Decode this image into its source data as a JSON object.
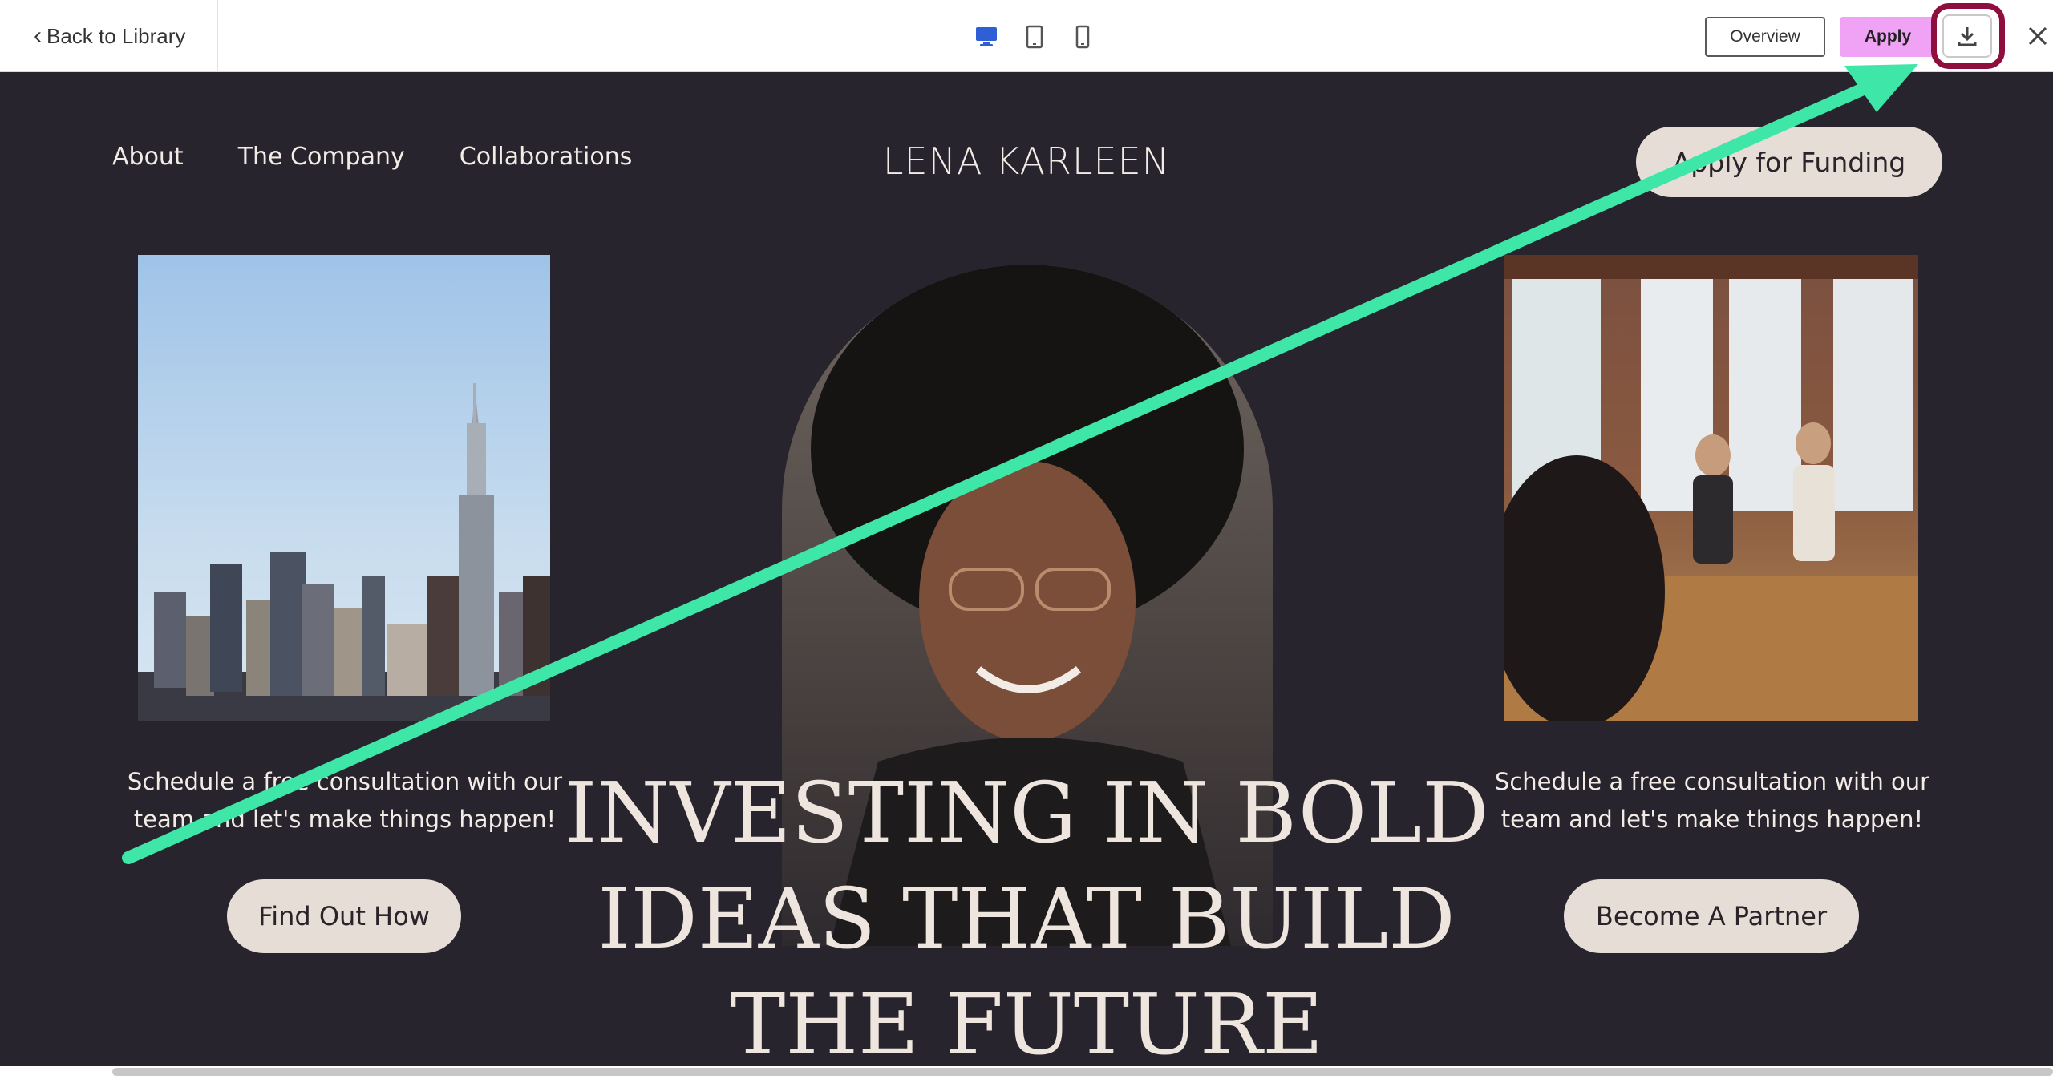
{
  "editor": {
    "back_label": "Back to Library",
    "devices": [
      "desktop-icon",
      "tablet-icon",
      "mobile-icon"
    ],
    "overview_label": "Overview",
    "apply_label": "Apply",
    "download_icon": "download-icon",
    "close_icon": "close-icon"
  },
  "site": {
    "nav": [
      "About",
      "The Company",
      "Collaborations"
    ],
    "brand": "LENA KARLEEN",
    "cta_label": "Apply for Funding",
    "left_caption": "Schedule a free consultation with our team and let's make things happen!",
    "left_button": "Find Out How",
    "right_caption": "Schedule a free consultation with our team and let's make things happen!",
    "right_button": "Become A Partner",
    "headline_lines": [
      "INVESTING IN BOLD",
      "IDEAS THAT BUILD",
      "THE FUTURE"
    ]
  },
  "colors": {
    "apply_bg": "#f0a2f4",
    "highlight": "#8e0f3d",
    "annotation_arrow": "#3ee6a7",
    "preview_bg": "#28242d",
    "pill_bg": "#e6ddd6"
  }
}
